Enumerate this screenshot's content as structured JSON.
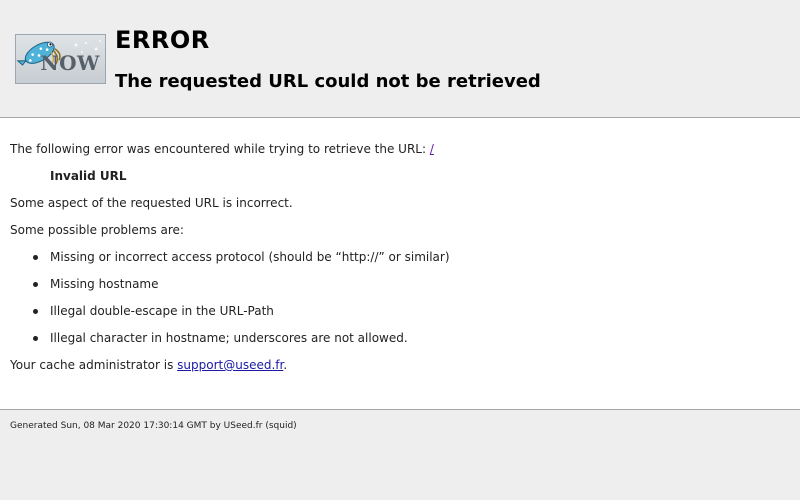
{
  "header": {
    "logo_text": "NOW",
    "title": "ERROR",
    "subtitle": "The requested URL could not be retrieved"
  },
  "content": {
    "intro_text": "The following error was encountered while trying to retrieve the URL: ",
    "url_link": "/",
    "error_name": "Invalid URL",
    "error_description": "Some aspect of the requested URL is incorrect.",
    "problems_heading": "Some possible problems are:",
    "problems": [
      "Missing or incorrect access protocol (should be “http://” or similar)",
      "Missing hostname",
      "Illegal double-escape in the URL-Path",
      "Illegal character in hostname; underscores are not allowed."
    ],
    "admin_text": "Your cache administrator is ",
    "admin_email": "support@useed.fr",
    "admin_suffix": "."
  },
  "footer": {
    "generated_text": "Generated Sun, 08 Mar 2020 17:30:14 GMT by USeed.fr (squid)"
  },
  "colors": {
    "background": "#eeeeee",
    "content_background": "#ffffff",
    "link": "#1a1aa6",
    "visited_link": "#6a1aa6",
    "divider": "#a8a8a8"
  }
}
